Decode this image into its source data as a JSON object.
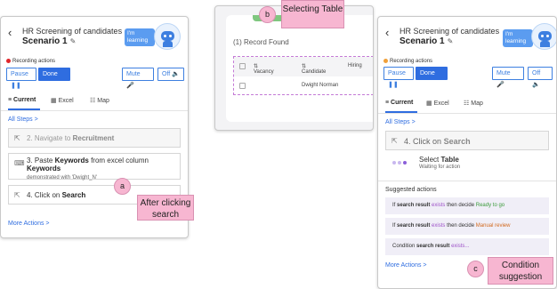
{
  "callouts": {
    "a": {
      "badge": "a",
      "label": "After clicking search"
    },
    "b": {
      "badge": "b",
      "label": "Selecting Table"
    },
    "c": {
      "badge": "c",
      "label": "Condition suggestion"
    }
  },
  "panel_left": {
    "back_icon": "chevron-left-icon",
    "title_line1": "HR Screening of candidates",
    "title_line2": "Scenario 1",
    "learning_badge": "I'm learning",
    "recording_label": "Recording actions",
    "pause_label": "Pause",
    "done_label": "Done",
    "mute_label": "Mute",
    "off_label": "Off",
    "tabs": [
      {
        "label": "Current"
      },
      {
        "label": "Excel"
      },
      {
        "label": "Map"
      }
    ],
    "all_steps": "All Steps >",
    "steps": [
      {
        "number": "2.",
        "text": "Navigate to",
        "bold": "Recruitment"
      },
      {
        "number": "3.",
        "text": "Paste",
        "bold": "Keywords",
        "middle": "from excel column",
        "bold2": "Keywords",
        "sub": "demonstrated with 'Dwight_N'"
      },
      {
        "number": "4.",
        "text": "Click on",
        "bold": "Search"
      }
    ],
    "more_actions": "More Actions >"
  },
  "panel_middle": {
    "record_found": "(1) Record Found",
    "columns": [
      "Vacancy",
      "Candidate",
      "Hiring"
    ],
    "row": [
      "Dwight Norman"
    ]
  },
  "panel_right": {
    "title_line1": "HR Screening of candidates",
    "title_line2": "Scenario 1",
    "learning_badge": "I'm learning",
    "recording_label": "Recording actions",
    "pause_label": "Pause",
    "done_label": "Done",
    "mute_label": "Mute",
    "off_label": "Off",
    "tabs": [
      {
        "label": "Current"
      },
      {
        "label": "Excel"
      },
      {
        "label": "Map"
      }
    ],
    "all_steps": "All Steps >",
    "current_step": {
      "number": "4.",
      "text": "Click on",
      "bold": "Search"
    },
    "select": {
      "label": "Select",
      "bold": "Table",
      "status": "Waiting for action"
    },
    "suggested_title": "Suggested actions",
    "suggestions": [
      {
        "pre": "If",
        "bold": "search result",
        "cond": "exists",
        "mid": "then decide",
        "action": "Ready to go"
      },
      {
        "pre": "If",
        "bold": "search result",
        "cond": "exists",
        "mid": "then decide",
        "action": "Manual review"
      },
      {
        "pre": "Condition",
        "bold": "search result",
        "cond": "exists..."
      }
    ],
    "more_actions": "More Actions >"
  },
  "colors": {
    "accent": "#2f6de0",
    "callout": "#f7b6d1",
    "condition": "#9e52c8",
    "ready": "#3c9b3c",
    "review": "#d2691e"
  }
}
